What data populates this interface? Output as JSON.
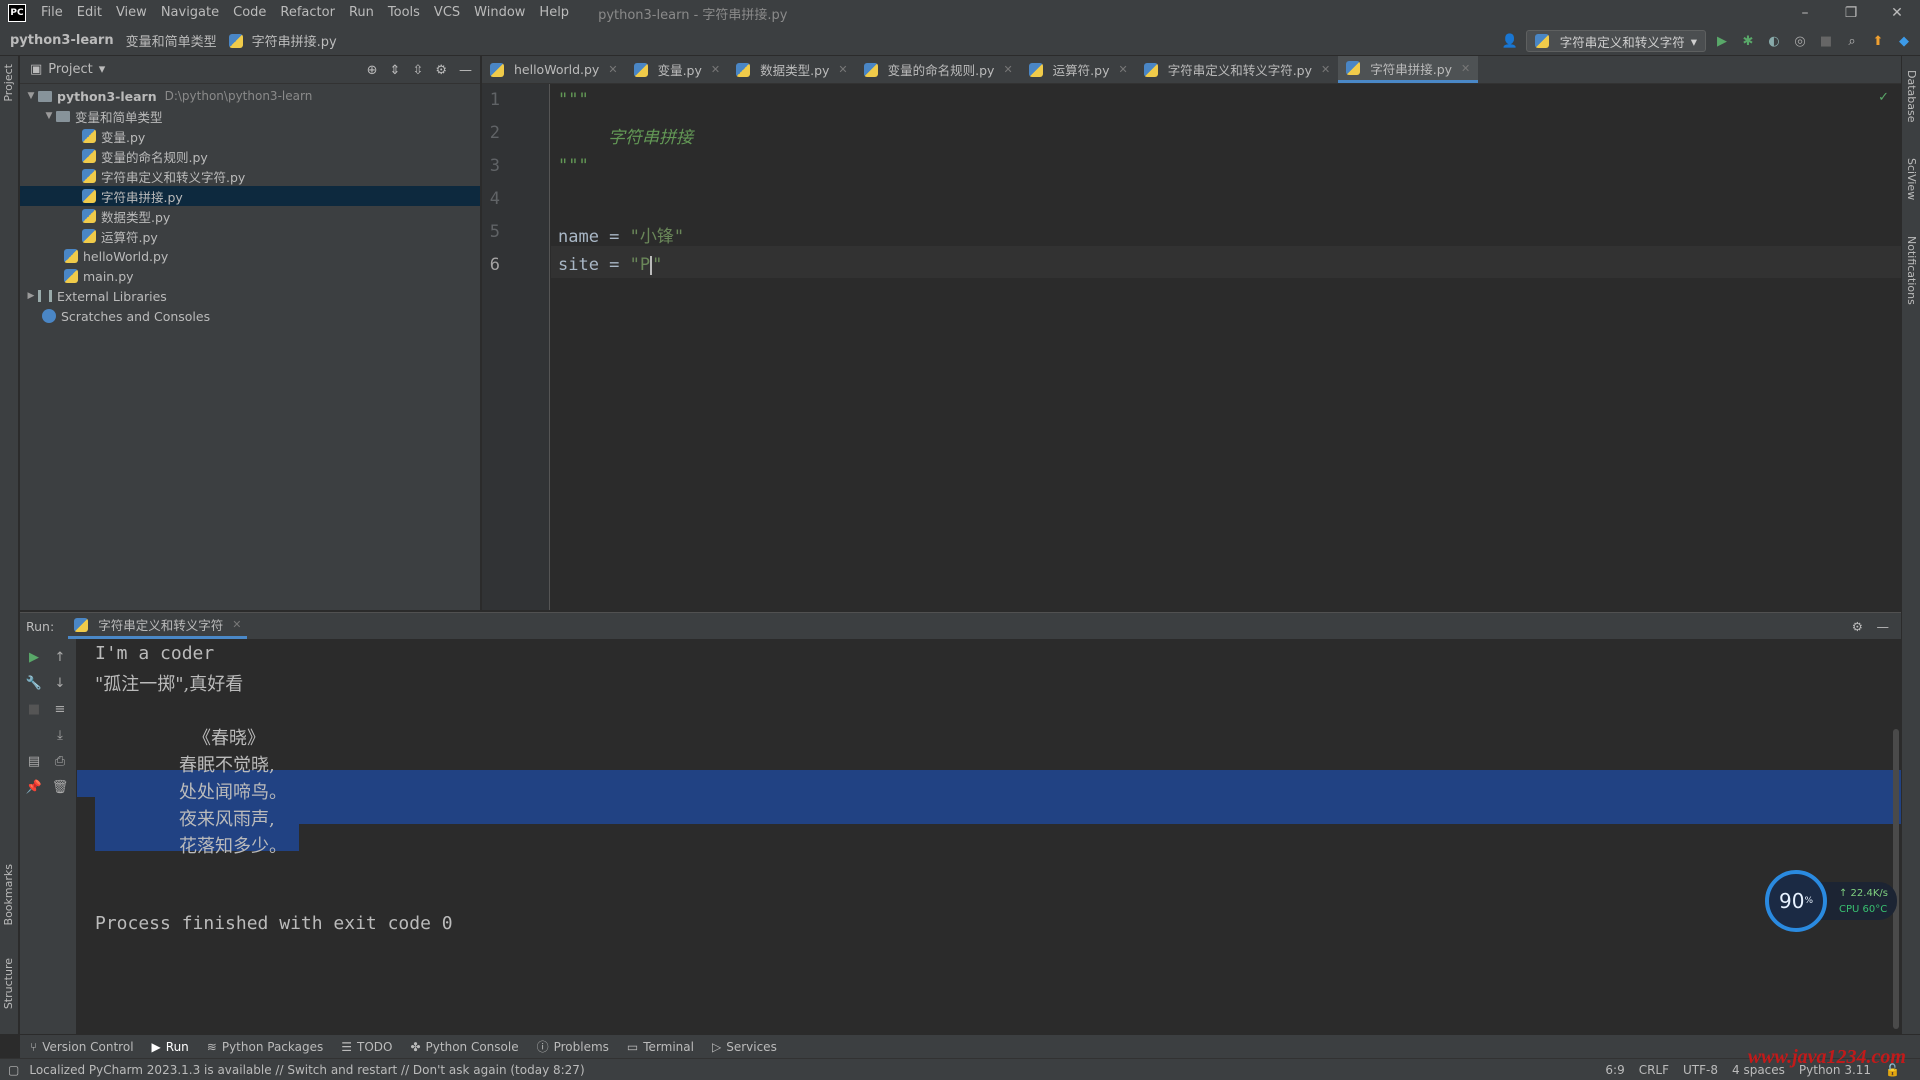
{
  "app": {
    "logo": "PC",
    "title": "python3-learn - 字符串拼接.py"
  },
  "menu": [
    "File",
    "Edit",
    "View",
    "Navigate",
    "Code",
    "Refactor",
    "Run",
    "Tools",
    "VCS",
    "Window",
    "Help"
  ],
  "window_controls": {
    "minimize": "–",
    "restore": "❐",
    "close": "✕"
  },
  "breadcrumb": {
    "project": "python3-learn",
    "folder": "变量和简单类型",
    "file": "字符串拼接.py"
  },
  "run_config": {
    "label": "字符串定义和转义字符"
  },
  "project_panel": {
    "title": "Project",
    "root": {
      "name": "python3-learn",
      "path": "D:\\python\\python3-learn"
    },
    "folder": "变量和简单类型",
    "files": [
      "变量.py",
      "变量的命名规则.py",
      "字符串定义和转义字符.py",
      "字符串拼接.py",
      "数据类型.py",
      "运算符.py"
    ],
    "root_files": [
      "helloWorld.py",
      "main.py"
    ],
    "external": "External Libraries",
    "scratches": "Scratches and Consoles"
  },
  "tabs": [
    "helloWorld.py",
    "变量.py",
    "数据类型.py",
    "变量的命名规则.py",
    "运算符.py",
    "字符串定义和转义字符.py",
    "字符串拼接.py"
  ],
  "editor": {
    "line_numbers": [
      "1",
      "2",
      "3",
      "4",
      "5",
      "6"
    ],
    "line1": "\"\"\"",
    "line2": "字符串拼接",
    "line3": "\"\"\"",
    "line5_var": "name = ",
    "line5_str": "\"小锋\"",
    "line6_var": "site = ",
    "line6_str_open": "\"P",
    "line6_str_close": "\""
  },
  "run_panel": {
    "label": "Run:",
    "tab": "字符串定义和转义字符",
    "output": [
      "I'm a coder",
      "\"孤注一掷\",真好看",
      "《春晓》",
      "春眠不觉晓,",
      "处处闻啼鸟。",
      "夜来风雨声,",
      "花落知多少。",
      "Process finished with exit code 0"
    ]
  },
  "perf_widget": {
    "value": "90",
    "unit": "%",
    "net": "↑ 22.4K/s",
    "cpu": "CPU 60°C"
  },
  "bottom_tabs": [
    "Version Control",
    "Run",
    "Python Packages",
    "TODO",
    "Python Console",
    "Problems",
    "Terminal",
    "Services"
  ],
  "status": {
    "message": "Localized PyCharm 2023.1.3 is available // Switch and restart // Don't ask again (today 8:27)",
    "position": "6:9",
    "line_sep": "CRLF",
    "encoding": "UTF-8",
    "indent": "4 spaces",
    "interpreter": "Python 3.11"
  },
  "side_labels": {
    "project": "Project",
    "bookmarks": "Bookmarks",
    "structure": "Structure",
    "database": "Database",
    "sciview": "SciView",
    "notifications": "Notifications"
  },
  "watermark": "www.java1234.com",
  "colors": {
    "accent": "#4a88c7",
    "selection": "#214283",
    "tree_selection": "#0d293e",
    "string": "#6a8759",
    "docstring": "#629755"
  }
}
